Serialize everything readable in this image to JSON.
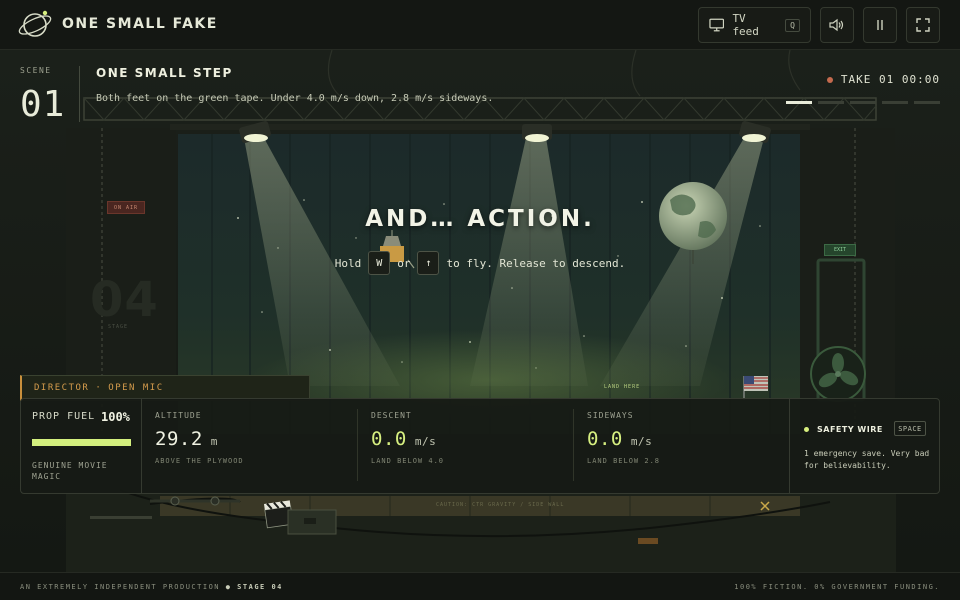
{
  "app": {
    "title": "ONE SMALL FAKE"
  },
  "toolbar": {
    "tv_label": "TV feed",
    "tv_key": "Q"
  },
  "scene": {
    "label": "SCENE",
    "number": "01",
    "title": "ONE SMALL STEP",
    "subtitle": "Both feet on the green tape. Under 4.0 m/s down, 2.8 m/s sideways.",
    "take": "TAKE 01 00:00",
    "progress_total": 5,
    "progress_done": 1
  },
  "message": {
    "title": "AND… ACTION.",
    "hint_pre": "Hold",
    "key_1": "W",
    "hint_mid": "or",
    "key_2": "↑",
    "hint_post": "to fly. Release to descend."
  },
  "props": {
    "on_air": "ON AIR",
    "exit": "EXIT",
    "stage_number": "04",
    "stage_label": "STAGE",
    "land_here": "LAND HERE",
    "caution": "CAUTION: CTR GRAVITY / SIDE WALL"
  },
  "director": {
    "label": "DIRECTOR",
    "separator": "·",
    "mode": "OPEN MIC"
  },
  "hud": {
    "fuel": {
      "label": "PROP FUEL",
      "value": "100%",
      "fraction": 1.0,
      "note": "GENUINE MOVIE MAGIC"
    },
    "altitude": {
      "label": "ALTITUDE",
      "value": "29.2",
      "unit": "m",
      "note": "ABOVE THE PLYWOOD"
    },
    "descent": {
      "label": "DESCENT",
      "value": "0.0",
      "unit": "m/s",
      "note": "LAND BELOW 4.0"
    },
    "sideways": {
      "label": "SIDEWAYS",
      "value": "0.0",
      "unit": "m/s",
      "note": "LAND BELOW 2.8"
    },
    "safety": {
      "label": "SAFETY WIRE",
      "key": "SPACE",
      "note": "1 emergency save. Very bad for believability."
    }
  },
  "footer": {
    "left_text": "AN EXTREMELY INDEPENDENT PRODUCTION",
    "left_sep": "●",
    "left_stage": "STAGE 04",
    "right_text": "100% FICTION. 0% GOVERNMENT FUNDING."
  },
  "colors": {
    "accent_lime": "#d6ef80",
    "director_orange": "#d49b4c",
    "record_dot": "#c46a4e",
    "background": "#111410"
  },
  "icons": {
    "brand": "planet-orbit-icon",
    "tv": "monitor-icon",
    "sound": "speaker-icon",
    "pause": "pause-icon",
    "fullscreen": "fullscreen-icon"
  }
}
